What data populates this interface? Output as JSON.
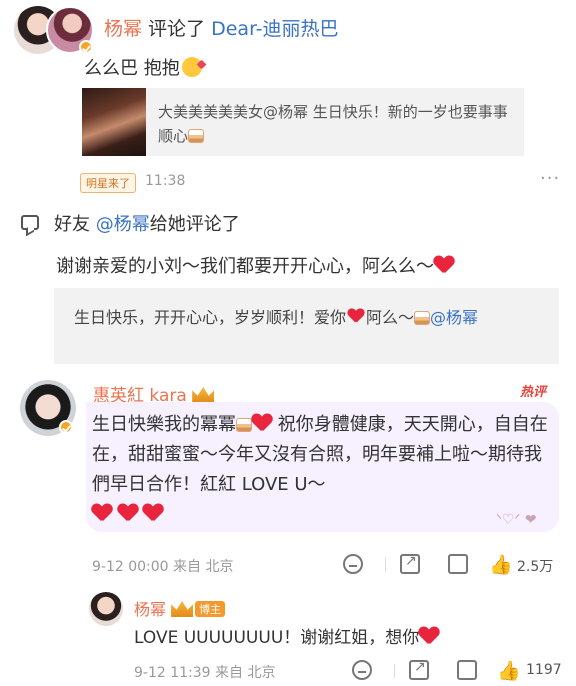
{
  "post1": {
    "user_name": "杨幂",
    "action": " 评论了 ",
    "target_user": "Dear-迪丽热巴",
    "comment": "么么巴 抱抱",
    "quote_text": "大美美美美美女@杨幂 生日快乐！新的一岁也要事事顺心",
    "badge": "明星来了",
    "time": "11:38",
    "more": "···"
  },
  "post2": {
    "prefix": "好友",
    "friend": "@杨幂",
    "suffix": "给她评论了",
    "reply": "谢谢亲爱的小刘～我们都要开开心心，阿么么～",
    "quote_before": "生日快乐，开开心心，岁岁顺利！爱你",
    "quote_middle": "阿么～",
    "quote_at": "@杨幂"
  },
  "comment1": {
    "user_name": "惠英紅 kara",
    "hot_label": "热评",
    "text_a": "生日快樂我的冪冪",
    "text_b": "祝你身體健康，天天開心，自自在在，甜甜蜜蜜～今年又沒有合照，明年要補上啦～期待我們早日合作！紅紅 LOVE U～",
    "deco": "ᐠ♡ᐟ ❤︎",
    "time": "9-12 00:00 来自 北京",
    "likes": "2.5万"
  },
  "reply1": {
    "user_name": "杨幂",
    "badge": "博主",
    "text": "LOVE UUUUUUUU！谢谢红姐，想你",
    "time": "9-12 11:39 来自 北京",
    "likes": "1197"
  },
  "icons": {
    "face": "smiley-icon",
    "share": "share-icon",
    "comment": "comment-icon",
    "like": "thumbs-up-icon",
    "heart": "red-heart-icon",
    "cake": "birthday-cake-icon",
    "crown": "crown-icon"
  },
  "colors": {
    "name": "#eb7350",
    "link": "#3a72c4",
    "heart": "#e8253c",
    "hot": "#e8453c",
    "bubble": "#f6f0ff"
  }
}
